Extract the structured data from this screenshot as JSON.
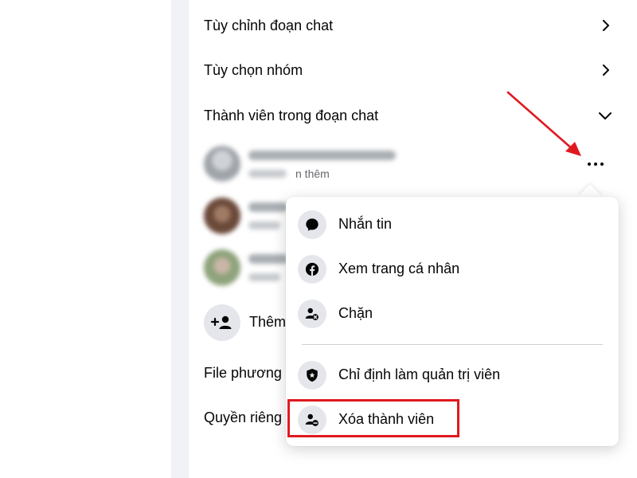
{
  "colors": {
    "annotation": "#e0191f",
    "icon_bg": "#e4e6eb",
    "text": "#050505",
    "secondary_text": "#65676b"
  },
  "settings": {
    "customize_chat": "Tùy chỉnh đoạn chat",
    "group_options": "Tùy chọn nhóm",
    "chat_members": "Thành viên trong đoạn chat",
    "files": "File phương",
    "privacy": "Quyền riêng"
  },
  "members": {
    "first_sub": "n thêm",
    "add_member_label": "Thêm"
  },
  "icons": {
    "customize_chat": "chevron-right-icon",
    "group_options": "chevron-right-icon",
    "chat_members": "chevron-down-icon",
    "more": "more-horizontal-icon",
    "add_member": "add-person-icon"
  },
  "menu": {
    "items": [
      {
        "label": "Nhắn tin",
        "icon": "message-icon"
      },
      {
        "label": "Xem trang cá nhân",
        "icon": "facebook-icon"
      },
      {
        "label": "Chặn",
        "icon": "block-user-icon"
      },
      {
        "label": "Chỉ định làm quản trị viên",
        "icon": "shield-star-icon"
      },
      {
        "label": "Xóa thành viên",
        "icon": "remove-user-icon"
      }
    ]
  }
}
